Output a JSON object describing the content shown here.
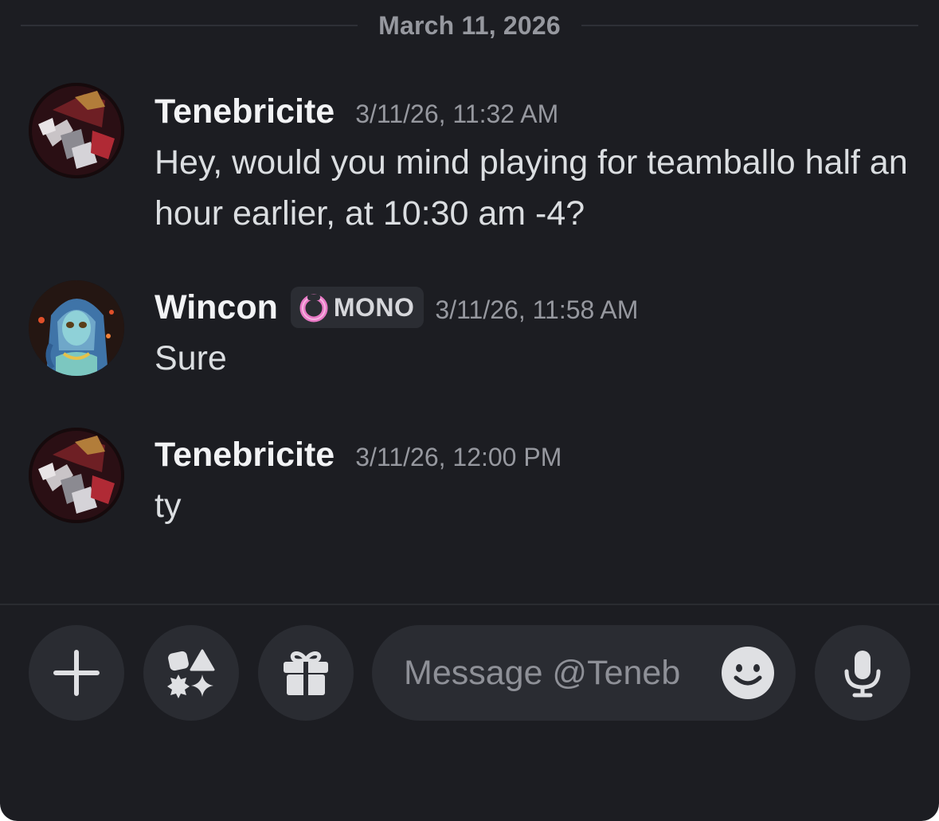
{
  "date_divider": "March 11, 2026",
  "messages": [
    {
      "username": "Tenebricite",
      "timestamp": "3/11/26, 11:32 AM",
      "text": "Hey, would you mind playing for teamballo half an hour earlier, at 10:30 am -4?",
      "avatar": "tenebricite-avatar"
    },
    {
      "username": "Wincon",
      "badge": "MONO",
      "badge_icon": "pink-ring-icon",
      "timestamp": "3/11/26, 11:58 AM",
      "text": "Sure",
      "avatar": "wincon-avatar"
    },
    {
      "username": "Tenebricite",
      "timestamp": "3/11/26, 12:00 PM",
      "text": "ty",
      "avatar": "tenebricite-avatar"
    }
  ],
  "composer": {
    "placeholder": "Message @Teneb...",
    "buttons": [
      "plus-icon",
      "apps-icon",
      "gift-icon",
      "emoji-icon",
      "microphone-icon"
    ]
  },
  "colors": {
    "background": "#1c1d22",
    "button_bg": "#2a2c32",
    "muted_text": "#96989f",
    "badge_pink": "#e879c5"
  }
}
